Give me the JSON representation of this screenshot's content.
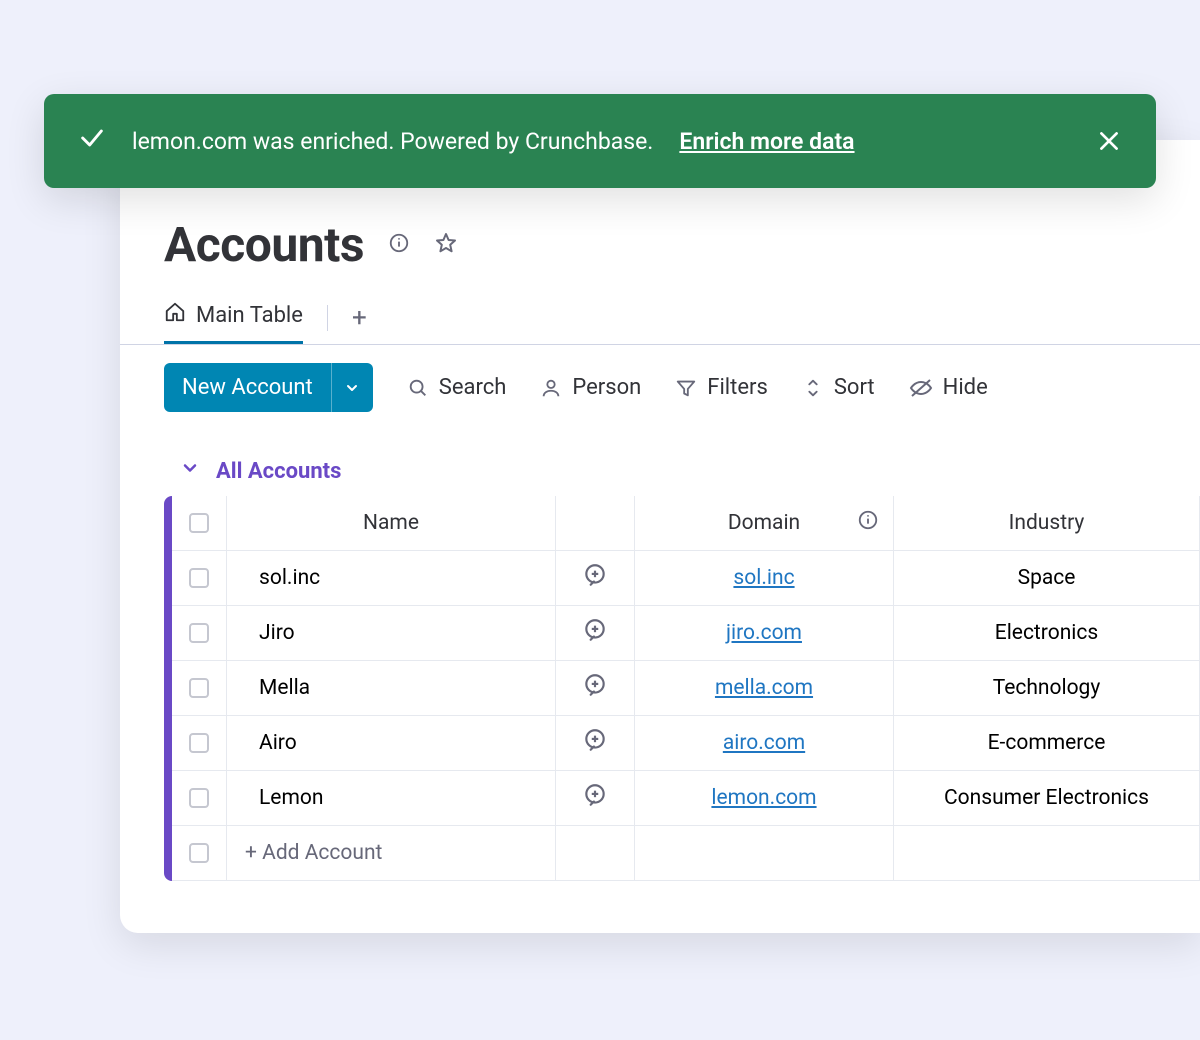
{
  "toast": {
    "message": "lemon.com was enriched. Powered by Crunchbase.",
    "link_label": "Enrich more data"
  },
  "page": {
    "title": "Accounts"
  },
  "tabs": {
    "main": "Main Table"
  },
  "toolbar": {
    "new_account": "New Account",
    "search": "Search",
    "person": "Person",
    "filters": "Filters",
    "sort": "Sort",
    "hide": "Hide"
  },
  "group": {
    "title": "All Accounts"
  },
  "columns": {
    "name": "Name",
    "domain": "Domain",
    "industry": "Industry"
  },
  "rows": [
    {
      "name": "sol.inc",
      "domain": "sol.inc",
      "industry": "Space"
    },
    {
      "name": "Jiro",
      "domain": "jiro.com",
      "industry": "Electronics"
    },
    {
      "name": "Mella",
      "domain": "mella.com",
      "industry": "Technology"
    },
    {
      "name": "Airo",
      "domain": "airo.com",
      "industry": "E-commerce"
    },
    {
      "name": "Lemon",
      "domain": "lemon.com",
      "industry": "Consumer Electronics"
    }
  ],
  "add_row_label": "+ Add Account"
}
